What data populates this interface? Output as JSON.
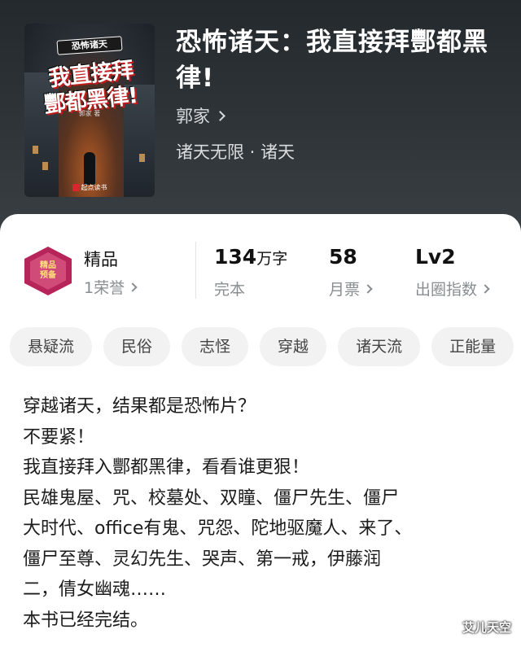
{
  "book": {
    "cover": {
      "tag": "恐怖诸天",
      "title_line1": "我直接拜",
      "title_line2": "酆都黑律!",
      "author_small": "郭家 著",
      "publisher": "起点读书"
    },
    "title": "恐怖诸天：我直接拜酆都黑律!",
    "author": "郭家",
    "genre": "诸天无限 · 诸天"
  },
  "stats": {
    "badge": {
      "line1": "精品",
      "line2": "预备"
    },
    "quality": {
      "label": "精品",
      "honor": "1荣誉"
    },
    "words": {
      "value": "134",
      "unit": "万字",
      "status": "完本"
    },
    "tickets": {
      "value": "58",
      "label": "月票"
    },
    "level": {
      "value": "Lv2",
      "label": "出圈指数"
    }
  },
  "tags": [
    "悬疑流",
    "民俗",
    "志怪",
    "穿越",
    "诸天流",
    "正能量"
  ],
  "description": [
    "穿越诸天，结果都是恐怖片？",
    "不要紧！",
    "我直接拜入酆都黑律，看看谁更狠！",
    "民雄鬼屋、咒、校墓处、双瞳、僵尸先生、僵尸",
    "大时代、office有鬼、咒怨、陀地驱魔人、来了、",
    "僵尸至尊、灵幻先生、哭声、第一戒，伊藤润",
    "二，倩女幽魂……",
    "本书已经完结。"
  ],
  "watermark": "艾儿天空",
  "colors": {
    "hero_bg": "#2f3539",
    "badge": "#b6245a",
    "chip_bg": "#f2f2f3"
  }
}
